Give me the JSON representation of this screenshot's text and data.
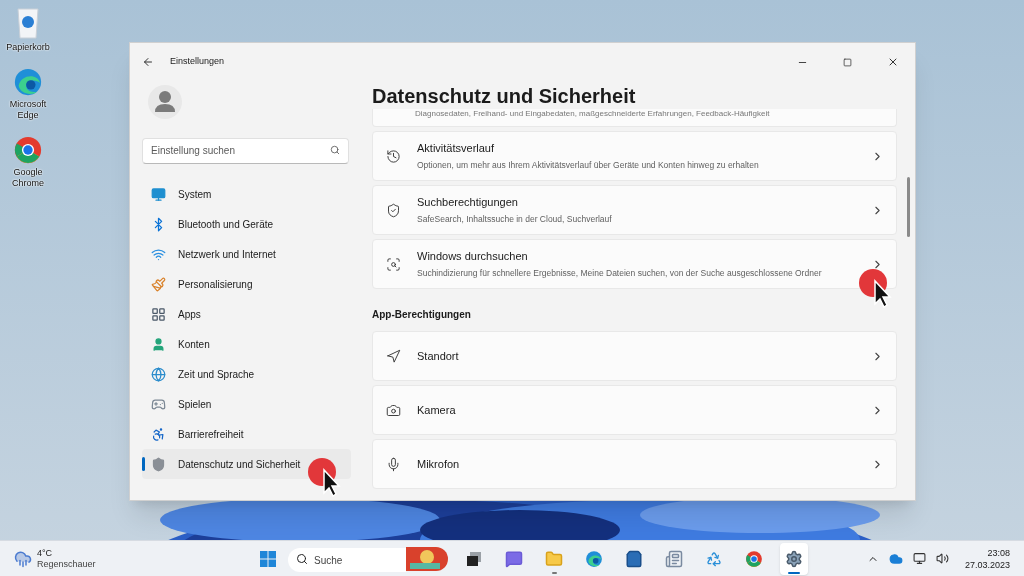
{
  "desktop_icons": [
    {
      "label": "Papierkorb",
      "kind": "recycle"
    },
    {
      "label": "Microsoft Edge",
      "kind": "edge"
    },
    {
      "label": "Google Chrome",
      "kind": "chrome"
    }
  ],
  "window": {
    "title": "Einstellungen"
  },
  "sidebar": {
    "search_placeholder": "Einstellung suchen",
    "items": [
      {
        "label": "System",
        "kind": "system",
        "selected": false
      },
      {
        "label": "Bluetooth und Geräte",
        "kind": "bluetooth",
        "selected": false
      },
      {
        "label": "Netzwerk und Internet",
        "kind": "network",
        "selected": false
      },
      {
        "label": "Personalisierung",
        "kind": "brush",
        "selected": false
      },
      {
        "label": "Apps",
        "kind": "apps",
        "selected": false
      },
      {
        "label": "Konten",
        "kind": "accounts",
        "selected": false
      },
      {
        "label": "Zeit und Sprache",
        "kind": "time",
        "selected": false
      },
      {
        "label": "Spielen",
        "kind": "gaming",
        "selected": false
      },
      {
        "label": "Barrierefreiheit",
        "kind": "accessibility",
        "selected": false
      },
      {
        "label": "Datenschutz und Sicherheit",
        "kind": "privacy",
        "selected": true
      }
    ]
  },
  "page": {
    "title": "Datenschutz und Sicherheit",
    "partial_description": "Diagnosedaten, Freihand- und Eingabedaten, maßgeschneiderte Erfahrungen, Feedback-Häufigkeit",
    "cards": [
      {
        "title": "Aktivitätsverlauf",
        "description": "Optionen, um mehr aus Ihrem Aktivitätsverlauf über Geräte und Konten hinweg zu erhalten",
        "kind": "history"
      },
      {
        "title": "Suchberechtigungen",
        "description": "SafeSearch, Inhaltssuche in der Cloud, Suchverlauf",
        "kind": "search-shield"
      },
      {
        "title": "Windows durchsuchen",
        "description": "Suchindizierung für schnellere Ergebnisse, Meine Dateien suchen, von der Suche ausgeschlossene Ordner",
        "kind": "search-windows"
      }
    ],
    "section_heading": "App-Berechtigungen",
    "permissions": [
      {
        "title": "Standort",
        "kind": "location"
      },
      {
        "title": "Kamera",
        "kind": "camera"
      },
      {
        "title": "Mikrofon",
        "kind": "microphone"
      }
    ]
  },
  "taskbar": {
    "weather": {
      "temperature": "4°C",
      "condition": "Regenschauer"
    },
    "search_placeholder": "Suche",
    "apps": [
      {
        "kind": "taskview",
        "running": false,
        "selected": false
      },
      {
        "kind": "chat",
        "running": false,
        "selected": false
      },
      {
        "kind": "folder",
        "running": true,
        "selected": false
      },
      {
        "kind": "edge",
        "running": false,
        "selected": false
      },
      {
        "kind": "store",
        "running": false,
        "selected": false
      },
      {
        "kind": "notes",
        "running": false,
        "selected": false
      },
      {
        "kind": "recycle",
        "running": false,
        "selected": false
      },
      {
        "kind": "chrome",
        "running": false,
        "selected": false
      },
      {
        "kind": "settings",
        "running": true,
        "selected": true
      }
    ],
    "time": "23:08",
    "date": "27.03.2023"
  }
}
